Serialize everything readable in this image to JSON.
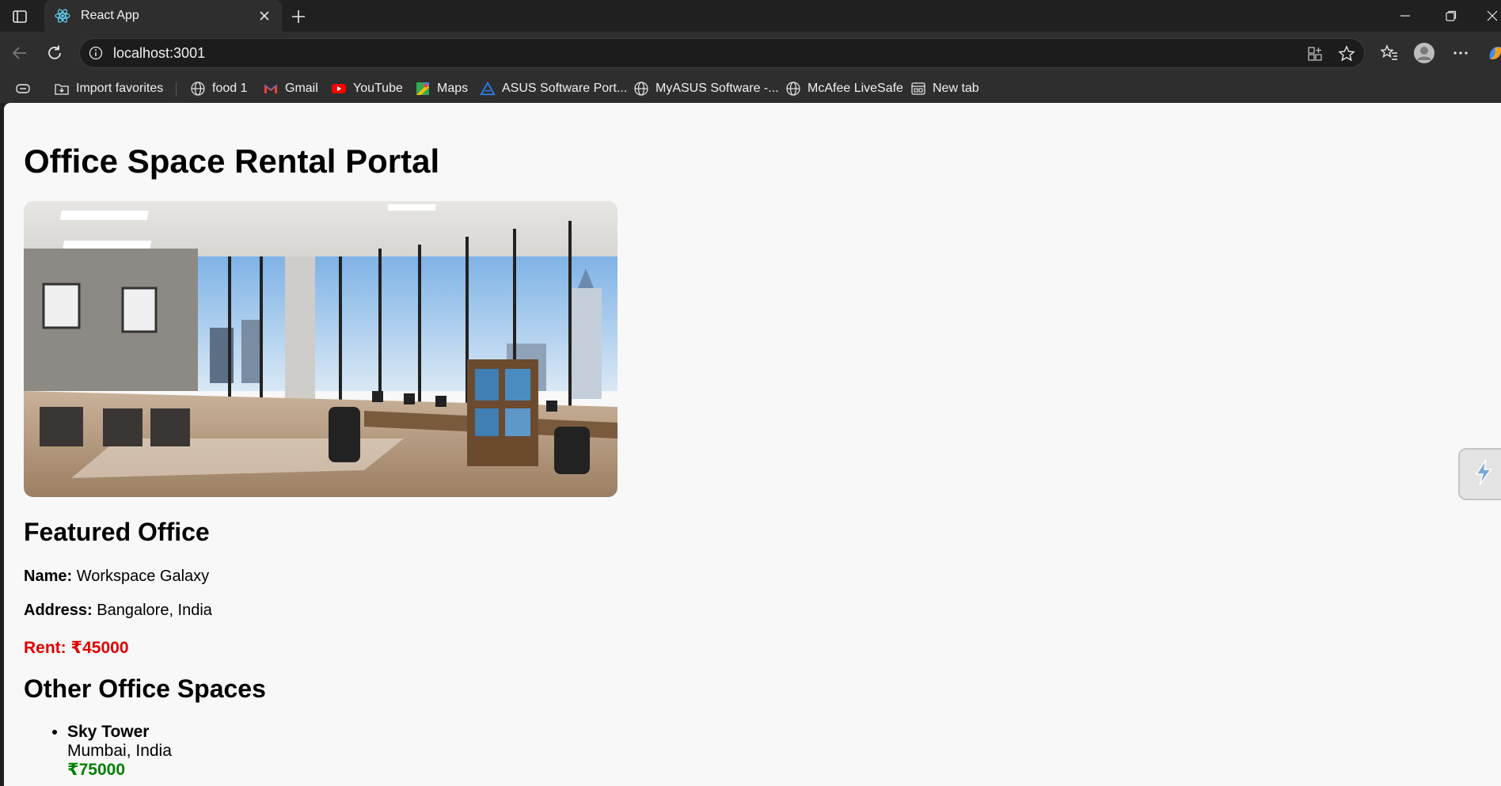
{
  "browser": {
    "tab": {
      "title": "React App"
    },
    "url": "localhost:3001",
    "bookmarks": [
      {
        "label": "Import favorites",
        "icon": "import-favorites-icon"
      },
      {
        "label": "food 1",
        "icon": "globe-icon"
      },
      {
        "label": "Gmail",
        "icon": "gmail-icon"
      },
      {
        "label": "YouTube",
        "icon": "youtube-icon"
      },
      {
        "label": "Maps",
        "icon": "maps-icon"
      },
      {
        "label": "ASUS Software Port...",
        "icon": "asus-icon"
      },
      {
        "label": "MyASUS Software -...",
        "icon": "globe-icon"
      },
      {
        "label": "McAfee LiveSafe",
        "icon": "globe-icon"
      },
      {
        "label": "New tab",
        "icon": "new-tab-page-icon"
      }
    ]
  },
  "page": {
    "title": "Office Space Rental Portal",
    "featured": {
      "heading": "Featured Office",
      "name_label": "Name:",
      "name": "Workspace Galaxy",
      "address_label": "Address:",
      "address": "Bangalore, India",
      "rent_label": "Rent:",
      "rent": "₹45000"
    },
    "others": {
      "heading": "Other Office Spaces",
      "items": [
        {
          "name": "Sky Tower",
          "address": "Mumbai, India",
          "price": "₹75000"
        }
      ]
    }
  },
  "colors": {
    "rent": "#e00000",
    "price": "#008000",
    "page_bg": "#f8f8f8",
    "chrome_bg": "#2e2e2e"
  }
}
